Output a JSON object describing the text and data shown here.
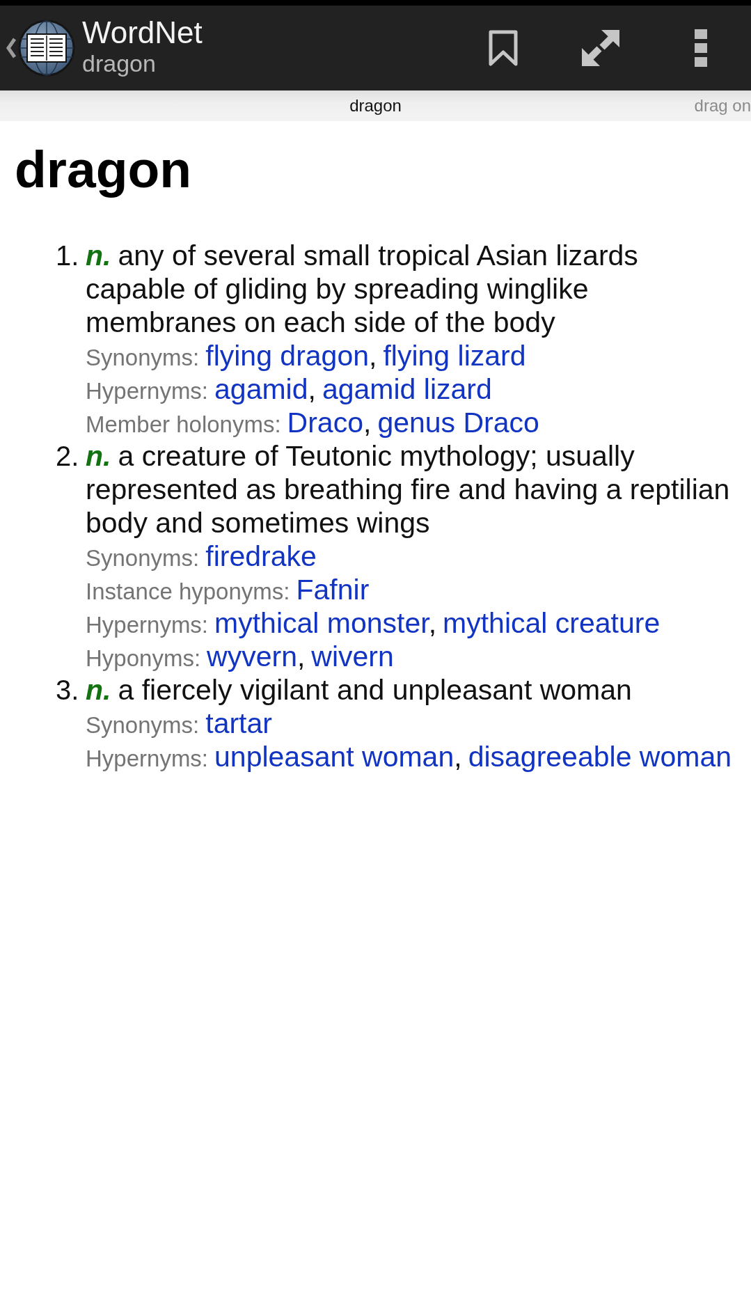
{
  "action_bar": {
    "title": "WordNet",
    "subtitle": "dragon"
  },
  "tabs": [
    {
      "label": "dragon",
      "selected": true
    },
    {
      "label": "drag on",
      "selected": false
    }
  ],
  "entry": {
    "headword": "dragon",
    "senses": [
      {
        "number": "1.",
        "pos": "n.",
        "gloss": "any of several small tropical Asian lizards capable of gliding by spreading winglike membranes on each side of the body",
        "relations": [
          {
            "label": "Synonyms:",
            "links": [
              {
                "text": "flying dragon",
                "separator": ","
              },
              {
                "text": "flying lizard"
              }
            ]
          },
          {
            "label": "Hypernyms:",
            "links": [
              {
                "text": "agamid",
                "separator": ","
              },
              {
                "text": "agamid lizard"
              }
            ]
          },
          {
            "label": "Member holonyms:",
            "links": [
              {
                "text": "Draco",
                "separator": ","
              },
              {
                "text": "genus Draco"
              }
            ]
          }
        ]
      },
      {
        "number": "2.",
        "pos": "n.",
        "gloss": "a creature of Teutonic mythology; usually represented as breathing fire and having a reptilian body and sometimes wings",
        "relations": [
          {
            "label": "Synonyms:",
            "links": [
              {
                "text": "firedrake"
              }
            ]
          },
          {
            "label": "Instance hyponyms:",
            "links": [
              {
                "text": "Fafnir"
              }
            ]
          },
          {
            "label": "Hypernyms:",
            "links": [
              {
                "text": "mythical monster",
                "separator": ","
              },
              {
                "text": "mythical creature"
              }
            ]
          },
          {
            "label": "Hyponyms:",
            "links": [
              {
                "text": "wyvern",
                "separator": ","
              },
              {
                "text": "wivern"
              }
            ]
          }
        ]
      },
      {
        "number": "3.",
        "pos": "n.",
        "gloss": "a fiercely vigilant and unpleasant woman",
        "relations": [
          {
            "label": "Synonyms:",
            "links": [
              {
                "text": "tartar"
              }
            ]
          },
          {
            "label": "Hypernyms:",
            "links": [
              {
                "text": "unpleasant woman",
                "separator": ","
              },
              {
                "text": "disagreeable woman"
              }
            ]
          }
        ]
      }
    ]
  }
}
